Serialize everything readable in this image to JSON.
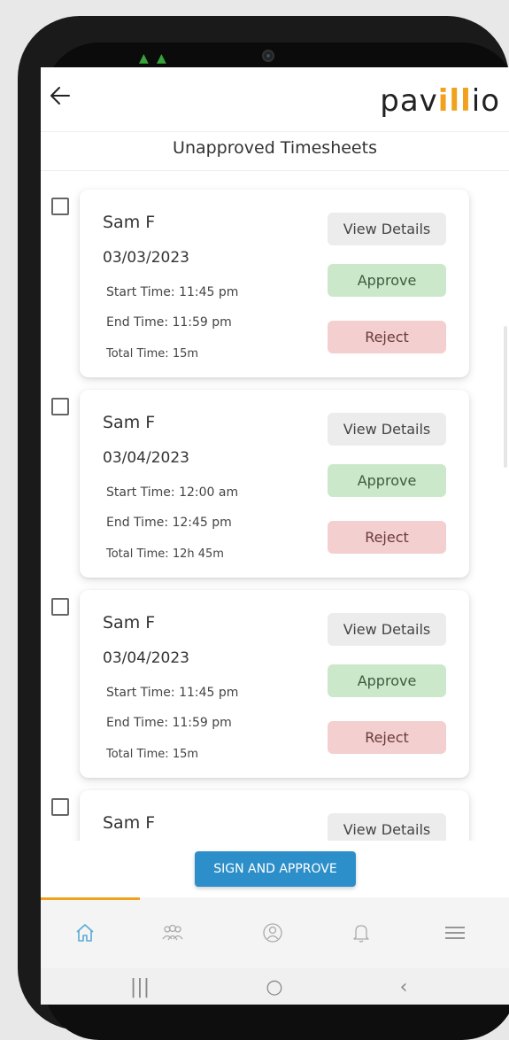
{
  "header": {
    "back_icon": "arrow-left-icon",
    "logo_parts": [
      "pav",
      "ill",
      "io"
    ]
  },
  "page_title": "Unapproved Timesheets",
  "timesheets": [
    {
      "name": "Sam F",
      "date": "03/03/2023",
      "start": "Start Time: 11:45 pm",
      "end": "End Time: 11:59 pm",
      "total": "Total Time: 15m"
    },
    {
      "name": "Sam F",
      "date": "03/04/2023",
      "start": "Start Time: 12:00 am",
      "end": "End Time: 12:45 pm",
      "total": "Total Time: 12h 45m"
    },
    {
      "name": "Sam F",
      "date": "03/04/2023",
      "start": "Start Time: 11:45 pm",
      "end": "End Time: 11:59 pm",
      "total": "Total Time: 15m"
    },
    {
      "name": "Sam F"
    }
  ],
  "buttons": {
    "view_details": "View Details",
    "approve": "Approve",
    "reject": "Reject",
    "sign_and_approve": "SIGN AND APPROVE"
  },
  "bottom_nav": {
    "items": [
      "home-icon",
      "people-icon",
      "contacts-icon",
      "bell-icon",
      "menu-icon"
    ],
    "active": "home-icon"
  },
  "system_nav": {
    "recents": "|||",
    "home": "○",
    "back": "‹"
  },
  "colors": {
    "accent": "#f0a21e",
    "primary_button": "#2d8fc9",
    "approve_bg": "#cbe8cb",
    "reject_bg": "#f3cfcf",
    "view_bg": "#ececec"
  }
}
